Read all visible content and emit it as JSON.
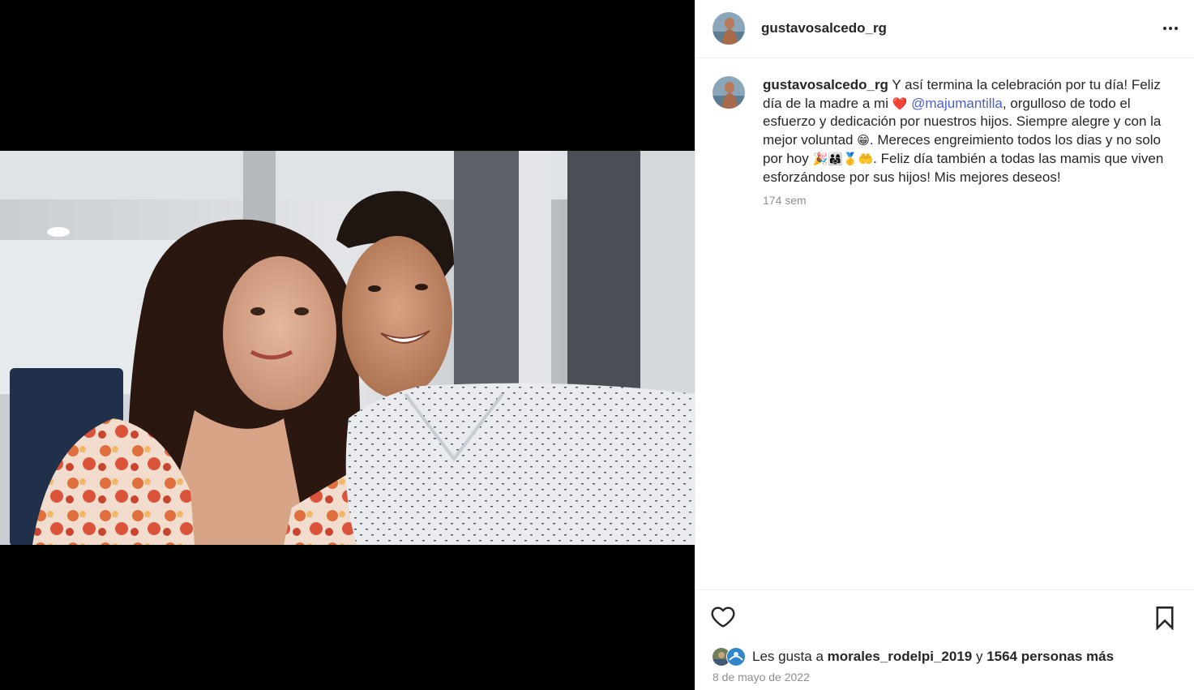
{
  "post": {
    "username": "gustavosalcedo_rg",
    "avatar_alt": "",
    "more_icon": "more-horizontal-icon"
  },
  "caption": {
    "username": "gustavosalcedo_rg",
    "text_part_1": " Y así termina la celebración por tu día! Feliz día de la madre a mi ",
    "heart_emoji": "❤️",
    "mention": "@majumantilla",
    "text_part_2": ", orgulloso de todo el esfuerzo y dedicación por nuestros hijos. Siempre alegre y con la mejor voluntad ",
    "grin_emoji": "😁",
    "text_part_3": ". Mereces engreimiento todos los dias y no solo por hoy ",
    "emoji_group": "🎉👨‍👩‍👧🥇🤲",
    "text_part_4": ". Feliz día también a todas las mamis que viven esforzándose por sus hijos! Mis mejores deseos!",
    "age": "174 sem"
  },
  "footer": {
    "like_icon": "heart-outline-icon",
    "save_icon": "bookmark-icon",
    "likes_prefix": "Les gusta a ",
    "first_liker": "morales_rodelpi_2019",
    "likes_connector": " y ",
    "likes_others": "1564 personas más",
    "date": "8 de mayo de 2022"
  },
  "colors": {
    "mention": "#4c61c8",
    "text": "#262626",
    "secondary": "#8e8e8e",
    "media_background": "#000000"
  }
}
